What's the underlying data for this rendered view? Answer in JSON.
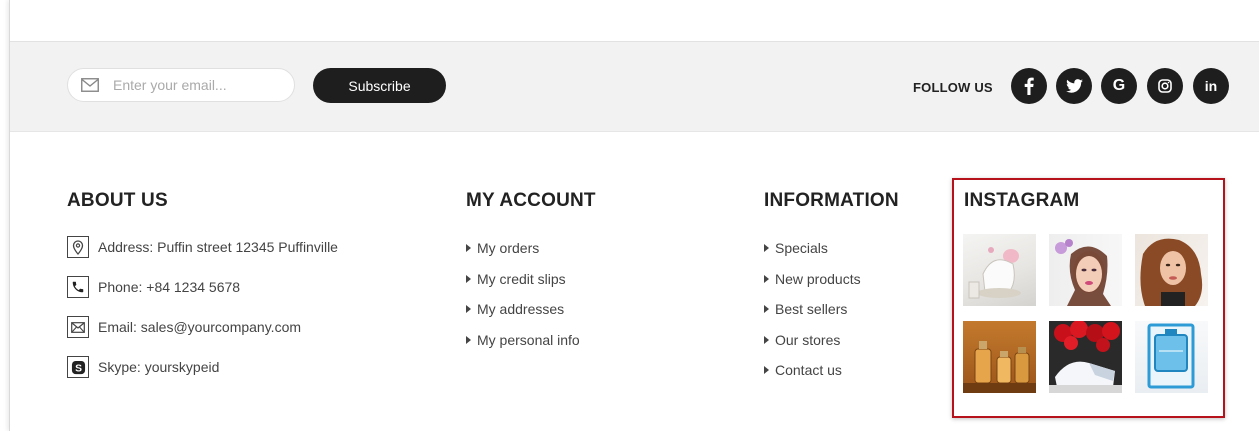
{
  "newsletter": {
    "email_placeholder": "Enter your email...",
    "subscribe_label": "Subscribe",
    "follow_label": "FOLLOW US"
  },
  "social": [
    {
      "name": "facebook",
      "glyph": "f"
    },
    {
      "name": "twitter",
      "glyph": "t"
    },
    {
      "name": "google",
      "glyph": "G"
    },
    {
      "name": "instagram",
      "glyph": "ig"
    },
    {
      "name": "linkedin",
      "glyph": "in"
    }
  ],
  "about": {
    "title": "ABOUT US",
    "items": [
      {
        "icon": "map-pin-icon",
        "text": "Address: Puffin street 12345 Puffinville"
      },
      {
        "icon": "phone-icon",
        "text": "Phone: +84 1234 5678"
      },
      {
        "icon": "envelope-icon",
        "text": "Email: sales@yourcompany.com"
      },
      {
        "icon": "skype-icon",
        "text": "Skype: yourskypeid"
      }
    ]
  },
  "my_account": {
    "title": "MY ACCOUNT",
    "links": [
      "My orders",
      "My credit slips",
      "My addresses",
      "My personal info"
    ]
  },
  "information": {
    "title": "INFORMATION",
    "links": [
      "Specials",
      "New products",
      "Best sellers",
      "Our stores",
      "Contact us"
    ]
  },
  "instagram": {
    "title": "INSTAGRAM",
    "thumbs": [
      {
        "subject": "perfume-and-flowers"
      },
      {
        "subject": "woman-portrait-makeup"
      },
      {
        "subject": "woman-portrait-hair"
      },
      {
        "subject": "perfume-bottles-gold"
      },
      {
        "subject": "red-roses-gift"
      },
      {
        "subject": "blue-perfume-box"
      }
    ]
  }
}
